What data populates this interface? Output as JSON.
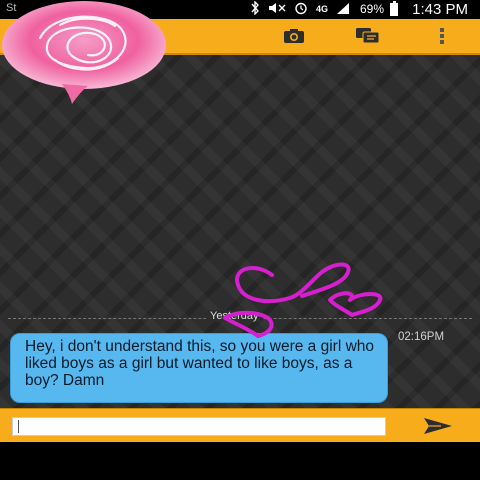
{
  "status_bar": {
    "carrier": "St",
    "icons": [
      "bluetooth-icon",
      "mute-icon",
      "alarm-icon",
      "lte-icon",
      "signal-icon"
    ],
    "network": "4G",
    "battery": "69%",
    "time": "1:43 PM"
  },
  "action_bar": {
    "accent": "#f7ad1b",
    "icons": [
      "camera-icon",
      "chat-icon",
      "overflow-menu-icon"
    ]
  },
  "conversation": {
    "date_divider": "Yesterday",
    "messages": [
      {
        "text": "Hey, i don't understand this, so you were a girl who liked boys as a girl but wanted to like boys, as a boy? Damn",
        "time": "02:16PM",
        "bubble_color": "#56b8ee"
      }
    ]
  },
  "compose": {
    "input_value": "",
    "input_placeholder": "",
    "send_icon": "send-icon"
  }
}
